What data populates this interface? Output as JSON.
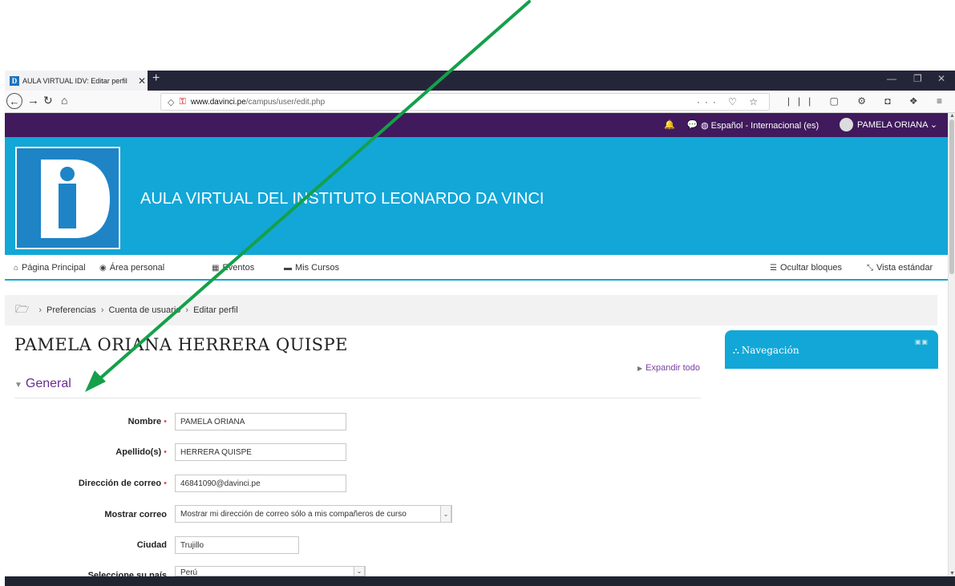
{
  "browser": {
    "tab_title": "AULA VIRTUAL IDV: Editar perfil",
    "tab_close": "✕",
    "new_tab": "+",
    "url_domain": "www.davinci.pe",
    "url_path": "/campus/user/edit.php",
    "url_right_icons": "··· ♡ ☆",
    "toolbar_icons": "||| ▢ ⚙ ◘ ❖ ≡",
    "favicon_letter": "D",
    "window_controls": {
      "minimize": "—",
      "restore": "❐",
      "close": "✕"
    }
  },
  "topbar": {
    "notification_icons": "🔔 💬",
    "language": "Español - Internacional (es)",
    "user_menu": "PAMELA ORIANA ⌄"
  },
  "banner": {
    "title": "AULA VIRTUAL DEL INSTITUTO LEONARDO DA VINCI"
  },
  "course_nav": {
    "items": [
      {
        "icon": "⌂",
        "label": "Página Principal"
      },
      {
        "icon": "◉",
        "label": "Área personal"
      },
      {
        "icon": "▦",
        "label": "Eventos"
      },
      {
        "icon": "▬",
        "label": "Mis Cursos"
      }
    ],
    "hide_blocks": "Ocultar bloques",
    "standard_view": "Vista estándar"
  },
  "breadcrumb": [
    "Preferencias",
    "Cuenta de usuario",
    "Editar perfil"
  ],
  "page_title": "PAMELA ORIANA HERRERA QUISPE",
  "expand_all": "Expandir todo",
  "section": "General",
  "form": {
    "nombre_label": "Nombre",
    "nombre_value": "PAMELA ORIANA",
    "apellido_label": "Apellido(s)",
    "apellido_value": "HERRERA QUISPE",
    "correo_label": "Dirección de correo",
    "correo_value": "46841090@davinci.pe",
    "mostrar_label": "Mostrar correo",
    "mostrar_value": "Mostrar mi dirección de correo sólo a mis compañeros de curso",
    "ciudad_label": "Ciudad",
    "ciudad_value": "Trujillo",
    "pais_label": "Seleccione su país",
    "pais_value": "Perú",
    "required_mark": "•"
  },
  "nav_block": {
    "title": "Navegación"
  },
  "colors": {
    "topbar": "#401a5c",
    "banner": "#12a7d7",
    "arrow": "#14a04a"
  }
}
